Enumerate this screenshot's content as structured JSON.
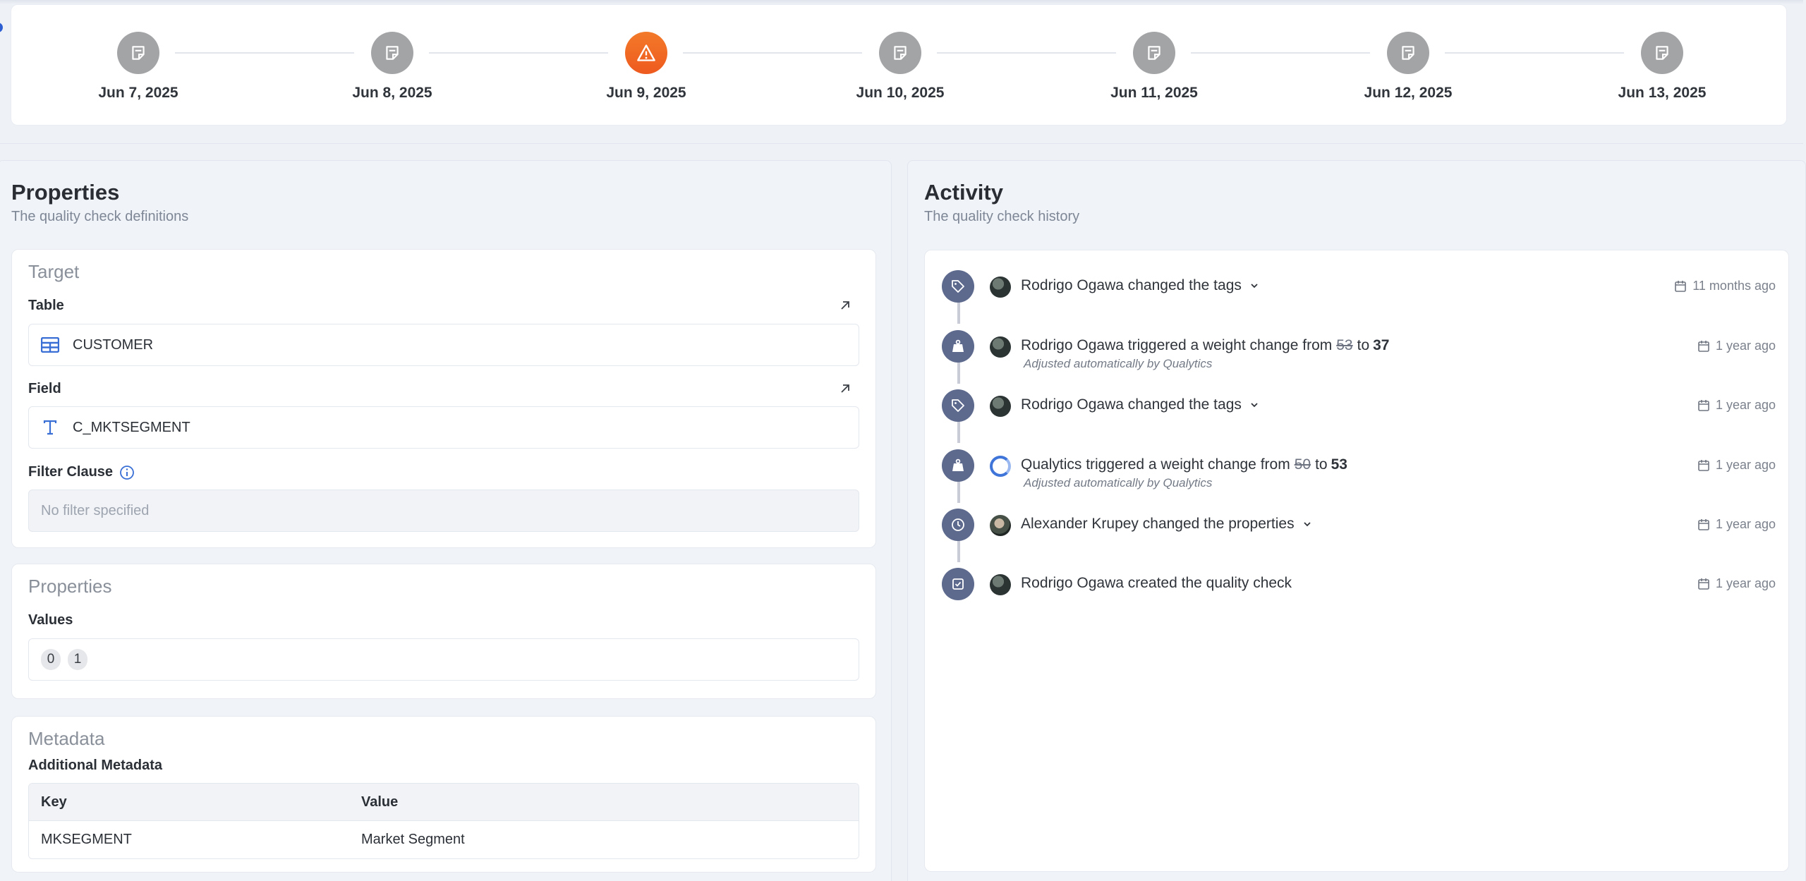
{
  "timeline": {
    "nodes": [
      {
        "date": "Jun 7, 2025",
        "icon": "note-icon",
        "status": "normal"
      },
      {
        "date": "Jun 8, 2025",
        "icon": "note-icon",
        "status": "normal"
      },
      {
        "date": "Jun 9, 2025",
        "icon": "warning-icon",
        "status": "anomaly"
      },
      {
        "date": "Jun 10, 2025",
        "icon": "note-icon",
        "status": "normal"
      },
      {
        "date": "Jun 11, 2025",
        "icon": "note-icon",
        "status": "normal"
      },
      {
        "date": "Jun 12, 2025",
        "icon": "note-icon",
        "status": "normal"
      },
      {
        "date": "Jun 13, 2025",
        "icon": "note-icon",
        "status": "normal"
      }
    ],
    "accent_warning": "#f16a24",
    "node_color": "#a3a4a6"
  },
  "properties": {
    "title": "Properties",
    "subtitle": "The quality check definitions",
    "target": {
      "heading": "Target",
      "table_label": "Table",
      "table_value": "CUSTOMER",
      "field_label": "Field",
      "field_value": "C_MKTSEGMENT",
      "filter_label": "Filter Clause",
      "filter_placeholder": "No filter specified"
    },
    "props": {
      "heading": "Properties",
      "values_label": "Values",
      "values": [
        "0",
        "1"
      ]
    },
    "metadata": {
      "heading": "Metadata",
      "sub_label": "Additional Metadata",
      "columns": [
        "Key",
        "Value"
      ],
      "rows": [
        [
          "MKSEGMENT",
          "Market Segment"
        ]
      ]
    }
  },
  "activity": {
    "title": "Activity",
    "subtitle": "The quality check history",
    "items": [
      {
        "icon": "tag-icon",
        "actor": "Rodrigo Ogawa",
        "text": "Rodrigo Ogawa changed the tags",
        "expandable": true,
        "time": "11 months ago"
      },
      {
        "icon": "weight-icon",
        "actor": "Rodrigo Ogawa",
        "text": "Rodrigo Ogawa triggered a weight change from",
        "from": "53",
        "to_word": "to",
        "to": "37",
        "note": "Adjusted automatically by Qualytics",
        "time": "1 year ago"
      },
      {
        "icon": "tag-icon",
        "actor": "Rodrigo Ogawa",
        "text": "Rodrigo Ogawa changed the tags",
        "expandable": true,
        "time": "1 year ago"
      },
      {
        "icon": "weight-icon",
        "actor": "Qualytics",
        "text": "Qualytics triggered a weight change from",
        "from": "50",
        "to_word": "to",
        "to": "53",
        "note": "Adjusted automatically by Qualytics",
        "time": "1 year ago"
      },
      {
        "icon": "clock-icon",
        "actor": "Alexander Krupey",
        "text": "Alexander Krupey changed the properties",
        "expandable": true,
        "time": "1 year ago"
      },
      {
        "icon": "check-square-icon",
        "actor": "Rodrigo Ogawa",
        "text": "Rodrigo Ogawa created the quality check",
        "time": "1 year ago"
      }
    ]
  }
}
